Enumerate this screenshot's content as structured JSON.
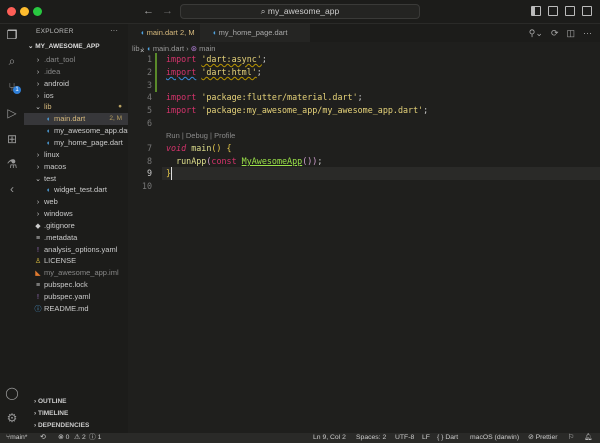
{
  "titlebar": {
    "back": "←",
    "forward": "→",
    "search": "my_awesome_app"
  },
  "activity": {
    "scm_badge": "1"
  },
  "explorer": {
    "title": "EXPLORER",
    "more": "···",
    "root": "MY_AWESOME_APP",
    "items": [
      {
        "label": ".dart_tool",
        "icon": "›",
        "cls": "dim",
        "indent": 1
      },
      {
        "label": ".idea",
        "icon": "›",
        "cls": "dim",
        "indent": 1
      },
      {
        "label": "android",
        "icon": "›",
        "cls": "",
        "indent": 1
      },
      {
        "label": "ios",
        "icon": "›",
        "cls": "",
        "indent": 1
      },
      {
        "label": "lib",
        "icon": "⌄",
        "cls": "mod",
        "indent": 1,
        "mark": "●"
      },
      {
        "label": "main.dart",
        "icon": "◖",
        "cls": "mod",
        "indent": 2,
        "mark": "2, M",
        "selected": true
      },
      {
        "label": "my_awesome_app.dart",
        "icon": "◖",
        "cls": "",
        "indent": 2
      },
      {
        "label": "my_home_page.dart",
        "icon": "◖",
        "cls": "",
        "indent": 2
      },
      {
        "label": "linux",
        "icon": "›",
        "cls": "",
        "indent": 1
      },
      {
        "label": "macos",
        "icon": "›",
        "cls": "",
        "indent": 1
      },
      {
        "label": "test",
        "icon": "⌄",
        "cls": "",
        "indent": 1
      },
      {
        "label": "widget_test.dart",
        "icon": "◖",
        "cls": "",
        "indent": 2
      },
      {
        "label": "web",
        "icon": "›",
        "cls": "",
        "indent": 1
      },
      {
        "label": "windows",
        "icon": "›",
        "cls": "",
        "indent": 1
      },
      {
        "label": ".gitignore",
        "icon": "◆",
        "cls": "",
        "indent": 1
      },
      {
        "label": ".metadata",
        "icon": "≡",
        "cls": "",
        "indent": 1
      },
      {
        "label": "analysis_options.yaml",
        "icon": "!",
        "cls": "",
        "indent": 1
      },
      {
        "label": "LICENSE",
        "icon": "♙",
        "cls": "",
        "indent": 1
      },
      {
        "label": "my_awesome_app.iml",
        "icon": "◣",
        "cls": "dim",
        "indent": 1
      },
      {
        "label": "pubspec.lock",
        "icon": "≡",
        "cls": "",
        "indent": 1
      },
      {
        "label": "pubspec.yaml",
        "icon": "!",
        "cls": "",
        "indent": 1
      },
      {
        "label": "README.md",
        "icon": "ⓘ",
        "cls": "",
        "indent": 1
      }
    ],
    "sections": [
      "OUTLINE",
      "TIMELINE",
      "DEPENDENCIES"
    ]
  },
  "tabs": [
    {
      "label": "main.dart",
      "badge": "2, M",
      "close": "×"
    },
    {
      "label": "my_home_page.dart"
    }
  ],
  "breadcrumb": {
    "folder": "lib",
    "file": "main.dart",
    "symbol": "main"
  },
  "code": {
    "line_numbers": [
      "1",
      "2",
      "3",
      "4",
      "5",
      "6",
      "7",
      "8",
      "9",
      "10"
    ],
    "l1_kw": "import",
    "l1_str": "'dart:async'",
    "l1_end": ";",
    "l2_kw": "import",
    "l2_str": "'dart:html'",
    "l2_end": ";",
    "l4_kw": "import",
    "l4_str": "'package:flutter/material.dart'",
    "l4_end": ";",
    "l5_kw": "import",
    "l5_str": "'package:my_awesome_app/my_awesome_app.dart'",
    "l5_end": ";",
    "codelens": "Run | Debug | Profile",
    "l7_kw": "void",
    "l7_fn": "main",
    "l7_rest": "() {",
    "l8_fn": "runApp",
    "l8_open": "(",
    "l8_kw": "const",
    "l8_cls": "MyAwesomeApp",
    "l8_rest": "())",
    "l8_end": ";",
    "l9": "}"
  },
  "status": {
    "branch": "main*",
    "sync": "⟲",
    "errors": "⊗ 0",
    "warnings": "⚠ 2",
    "info": "ⓘ 1",
    "position": "Ln 9, Col 2",
    "spaces": "Spaces: 2",
    "encoding": "UTF-8",
    "eol": "LF",
    "language": "{ } Dart",
    "platform": "macOS (darwin)",
    "formatter": "⊘ Prettier"
  }
}
